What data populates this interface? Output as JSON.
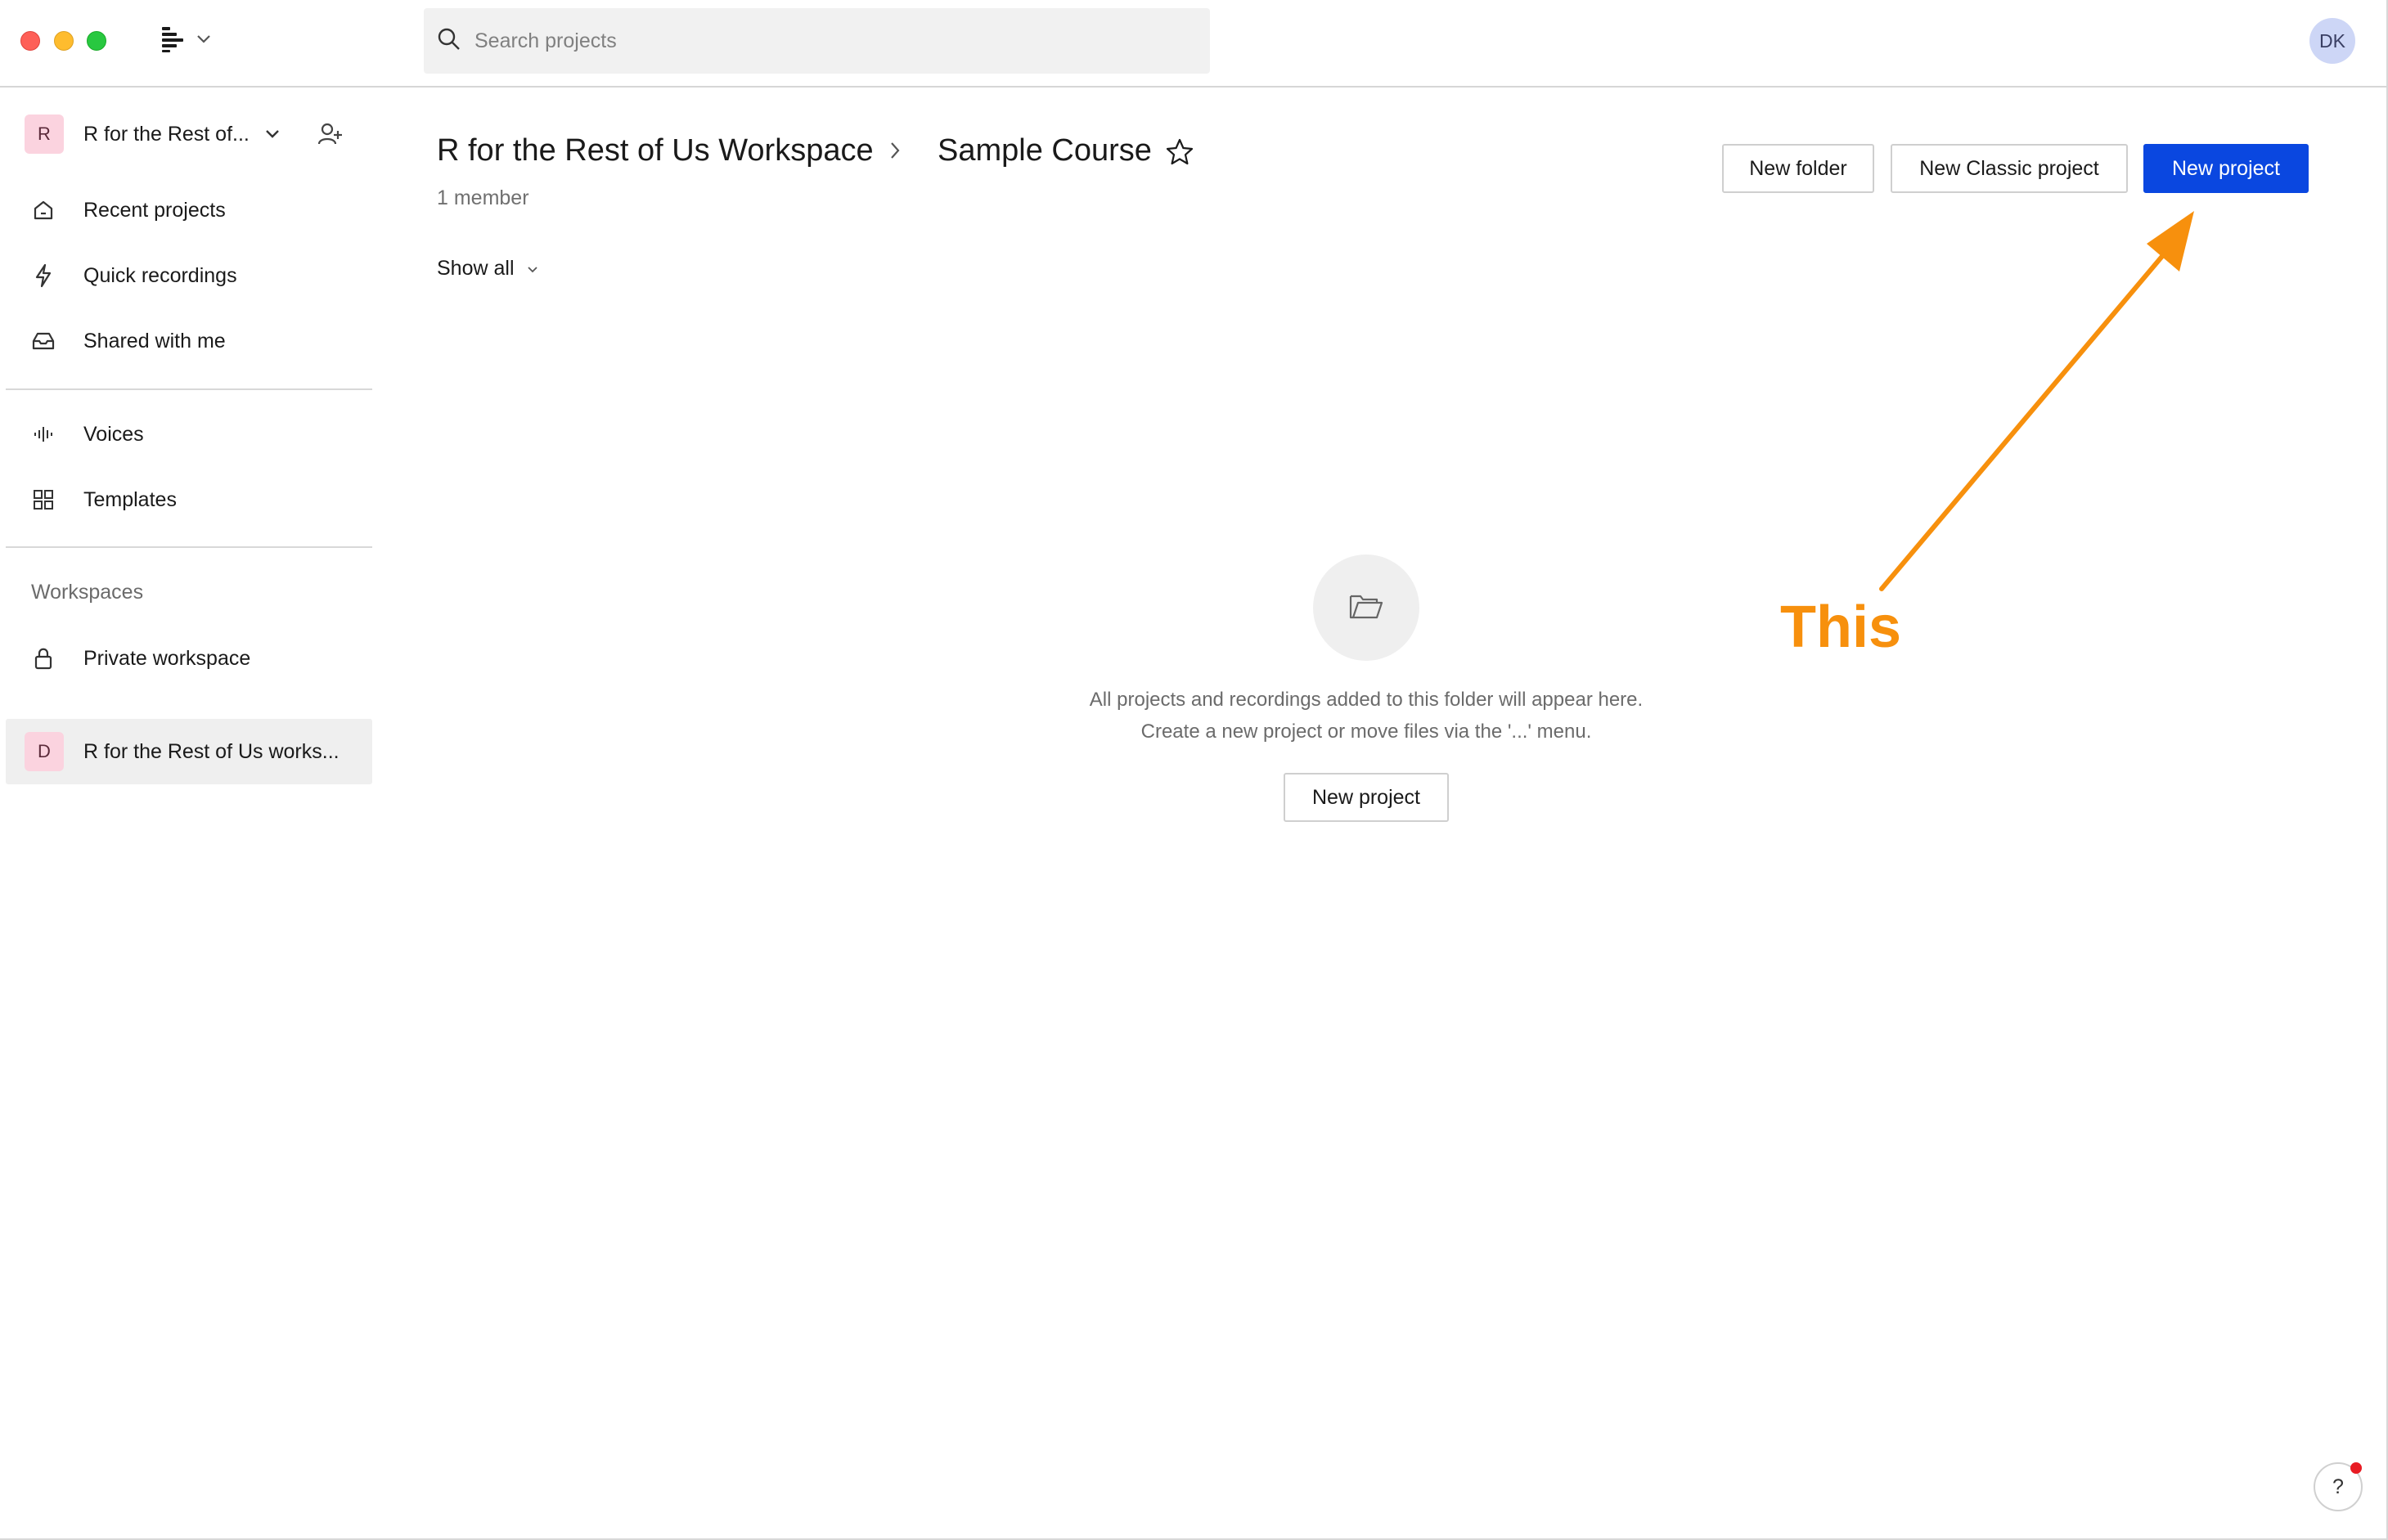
{
  "window": {
    "controls": [
      "close",
      "minimize",
      "zoom"
    ]
  },
  "topbar": {
    "app_icon": "app-logo-icon",
    "search": {
      "placeholder": "Search projects",
      "value": ""
    },
    "user_initials": "DK"
  },
  "sidebar": {
    "workspace_switch": {
      "badge": "R",
      "name": "R for the Rest of..."
    },
    "nav": [
      {
        "label": "Recent projects",
        "icon": "home-icon"
      },
      {
        "label": "Quick recordings",
        "icon": "lightning-icon"
      },
      {
        "label": "Shared with me",
        "icon": "inbox-icon"
      }
    ],
    "nav2": [
      {
        "label": "Voices",
        "icon": "waveform-icon"
      },
      {
        "label": "Templates",
        "icon": "grid-icon"
      }
    ],
    "workspaces_label": "Workspaces",
    "private_workspace": {
      "label": "Private workspace",
      "icon": "lock-icon"
    },
    "active_workspace": {
      "badge": "D",
      "name": "R for the Rest of Us works..."
    }
  },
  "main": {
    "breadcrumb": {
      "root": "R for the Rest of Us Workspace",
      "current": "Sample Course"
    },
    "members": "1 member",
    "filter": "Show all",
    "buttons": {
      "new_folder": "New folder",
      "new_classic": "New Classic project",
      "new_project": "New project"
    },
    "empty_state": {
      "line1": "All projects and recordings added to this folder will appear here.",
      "line2": "Create a new project or move files via the '...' menu.",
      "button": "New project"
    }
  },
  "annotation": {
    "text": "This",
    "color": "#f7900d"
  },
  "help": {
    "label": "?"
  },
  "colors": {
    "primary": "#0a47e0",
    "workspace_badge": "#fbd3df",
    "avatar": "#cdd6f6",
    "notification_dot": "#e81b23"
  }
}
